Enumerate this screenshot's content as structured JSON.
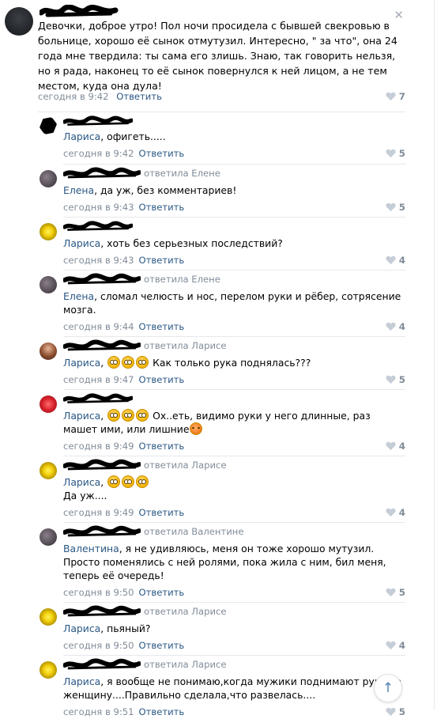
{
  "post": {
    "text": "Девочки, доброе утро! Пол ночи просидела с бывшей свекровью в больнице, хорошо её сынок отмутузил. Интересно, \" за что\", она 24 года мне твердила: ты сама его злишь. Знаю, так говорить нельзя, но я рада, наконец то её сынок повернулся к ней лицом, а не тем местом, куда она дула!",
    "time": "сегодня в 9:42",
    "reply_label": "Ответить",
    "likes": "7"
  },
  "comments": [
    {
      "header": "",
      "addressee": "Лариса",
      "text": ", офигеть.....",
      "time": "сегодня в 9:42",
      "reply": "Ответить",
      "likes": "5",
      "avatar": "dark"
    },
    {
      "header": "ответила Елене",
      "addressee": "Елена",
      "text": ", да уж, без комментариев!",
      "time": "сегодня в 9:43",
      "reply": "Ответить",
      "likes": "5",
      "avatar": "gray"
    },
    {
      "header": "",
      "addressee": "Лариса",
      "text": ", хоть без серьезных последствий?",
      "time": "сегодня в 9:43",
      "reply": "Ответить",
      "likes": "4",
      "avatar": "flower"
    },
    {
      "header": "ответила Елене",
      "addressee": "Елена",
      "text": ", сломал челюсть и нос, перелом руки и рёбер, сотрясение мозга.",
      "time": "сегодня в 9:44",
      "reply": "Ответить",
      "likes": "4",
      "avatar": "gray"
    },
    {
      "header": "ответила Ларисе",
      "addressee": "Лариса",
      "text": "Как только рука поднялась???",
      "time": "сегодня в 9:47",
      "reply": "Ответить",
      "likes": "5",
      "avatar": "woman"
    },
    {
      "header": "",
      "addressee": "Лариса",
      "text": "Ох..еть, видимо руки у него длинные, раз машет ими, или лишние",
      "time": "сегодня в 9:49",
      "reply": "Ответить",
      "likes": "4",
      "avatar": "red"
    },
    {
      "header": "ответила Ларисе",
      "addressee": "Лариса",
      "text": "Да уж....",
      "time": "сегодня в 9:49",
      "reply": "Ответить",
      "likes": "4",
      "avatar": "flower"
    },
    {
      "header": "ответила Валентине",
      "addressee": "Валентина",
      "text": ", я не удивляюсь, меня он тоже хорошо мутузил. Просто поменялись с ней ролями, пока жила с ним, бил меня, теперь её очередь!",
      "time": "сегодня в 9:50",
      "reply": "Ответить",
      "likes": "5",
      "avatar": "gray"
    },
    {
      "header": "ответила Ларисе",
      "addressee": "Лариса",
      "text": ", пьяный?",
      "time": "сегодня в 9:50",
      "reply": "Ответить",
      "likes": "4",
      "avatar": "flower"
    },
    {
      "header": "ответила Ларисе",
      "addressee": "Лариса",
      "text": ", я вообще не понимаю,когда мужики поднимают руку на женщину....Правильно сделала,что развелась....",
      "time": "сегодня в 9:51",
      "reply": "Ответить",
      "likes": "5",
      "avatar": "flower"
    }
  ],
  "colors": {
    "link": "#2a5885",
    "meta": "#818c99",
    "divider": "#e7e8ec"
  },
  "icons": {
    "close": "close-icon",
    "like": "heart-icon",
    "scroll": "arrow-up-icon"
  }
}
